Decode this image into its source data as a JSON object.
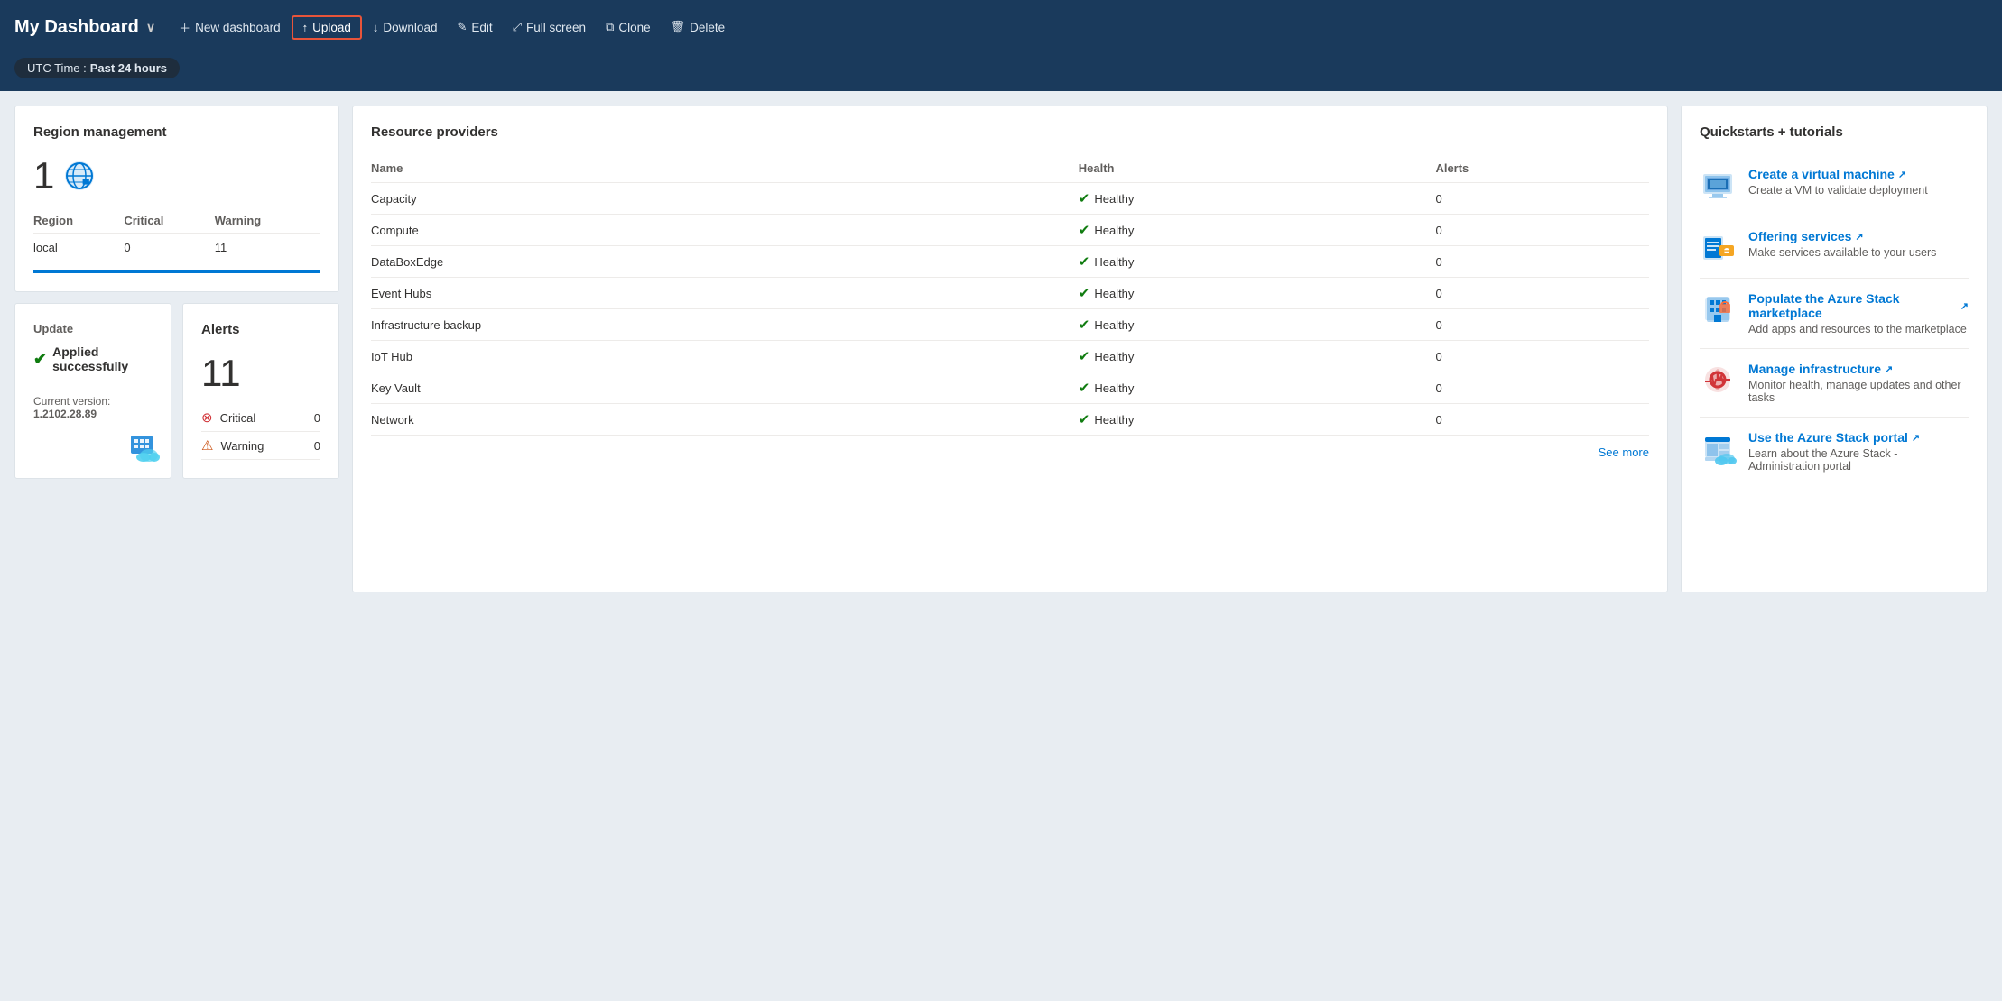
{
  "header": {
    "title": "My Dashboard",
    "chevron": "∨",
    "actions": [
      {
        "key": "new-dashboard",
        "icon": "＋",
        "label": "New dashboard"
      },
      {
        "key": "upload",
        "icon": "↑",
        "label": "Upload",
        "highlighted": true
      },
      {
        "key": "download",
        "icon": "↓",
        "label": "Download"
      },
      {
        "key": "edit",
        "icon": "✎",
        "label": "Edit"
      },
      {
        "key": "fullscreen",
        "icon": "⤢",
        "label": "Full screen"
      },
      {
        "key": "clone",
        "icon": "⧉",
        "label": "Clone"
      },
      {
        "key": "delete",
        "icon": "🗑",
        "label": "Delete"
      }
    ]
  },
  "utc": {
    "label": "UTC Time :",
    "value": "Past 24 hours"
  },
  "region_management": {
    "title": "Region management",
    "count": "1",
    "columns": [
      "Region",
      "Critical",
      "Warning"
    ],
    "rows": [
      {
        "region": "local",
        "critical": "0",
        "warning": "11"
      }
    ]
  },
  "update": {
    "title": "Update",
    "status": "Applied successfully",
    "version_label": "Current version:",
    "version": "1.2102.28.89"
  },
  "alerts": {
    "title": "Alerts",
    "count": "11",
    "rows": [
      {
        "icon": "critical",
        "label": "Critical",
        "count": "0"
      },
      {
        "icon": "warning",
        "label": "Warning",
        "count": "0"
      }
    ]
  },
  "resource_providers": {
    "title": "Resource providers",
    "columns": [
      "Name",
      "Health",
      "Alerts"
    ],
    "rows": [
      {
        "name": "Capacity",
        "health": "Healthy",
        "alerts": "0"
      },
      {
        "name": "Compute",
        "health": "Healthy",
        "alerts": "0"
      },
      {
        "name": "DataBoxEdge",
        "health": "Healthy",
        "alerts": "0"
      },
      {
        "name": "Event Hubs",
        "health": "Healthy",
        "alerts": "0"
      },
      {
        "name": "Infrastructure backup",
        "health": "Healthy",
        "alerts": "0"
      },
      {
        "name": "IoT Hub",
        "health": "Healthy",
        "alerts": "0"
      },
      {
        "name": "Key Vault",
        "health": "Healthy",
        "alerts": "0"
      },
      {
        "name": "Network",
        "health": "Healthy",
        "alerts": "0"
      }
    ],
    "see_more": "See more"
  },
  "quickstarts": {
    "title": "Quickstarts + tutorials",
    "items": [
      {
        "key": "create-vm",
        "link": "Create a virtual machine",
        "desc": "Create a VM to validate deployment"
      },
      {
        "key": "offering-services",
        "link": "Offering services",
        "desc": "Make services available to your users"
      },
      {
        "key": "marketplace",
        "link": "Populate the Azure Stack marketplace",
        "desc": "Add apps and resources to the marketplace"
      },
      {
        "key": "manage-infra",
        "link": "Manage infrastructure",
        "desc": "Monitor health, manage updates and other tasks"
      },
      {
        "key": "azure-portal",
        "link": "Use the Azure Stack portal",
        "desc": "Learn about the Azure Stack - Administration portal"
      }
    ]
  }
}
